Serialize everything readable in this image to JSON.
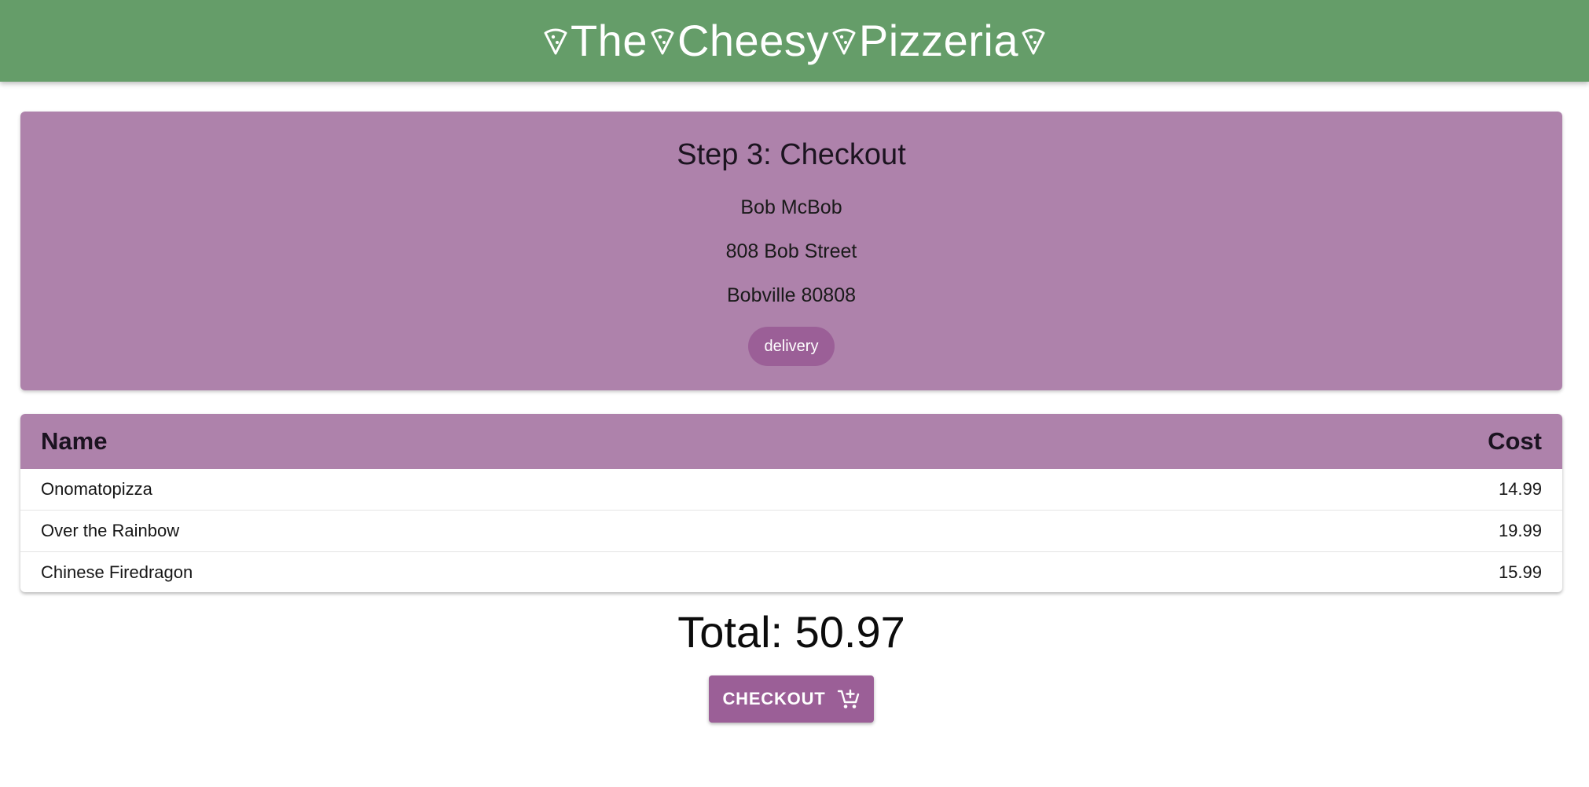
{
  "header": {
    "title_words": [
      "The",
      "Cheesy",
      "Pizzeria"
    ],
    "icon": "pizza-slice-icon",
    "background": "#659d69"
  },
  "checkout": {
    "heading": "Step 3: Checkout",
    "customer_name": "Bob McBob",
    "address_line1": "808 Bob Street",
    "address_line2": "Bobville 80808",
    "method_chip": "delivery",
    "card_color": "#ae82ab",
    "accent": "#9b5f97"
  },
  "order_table": {
    "columns": [
      "Name",
      "Cost"
    ],
    "rows": [
      {
        "name": "Onomatopizza",
        "cost": "14.99"
      },
      {
        "name": "Over the Rainbow",
        "cost": "19.99"
      },
      {
        "name": "Chinese Firedragon",
        "cost": "15.99"
      }
    ]
  },
  "total_label": "Total: 50.97",
  "checkout_button": {
    "label": "CHECKOUT",
    "icon": "add-shopping-cart-icon"
  }
}
